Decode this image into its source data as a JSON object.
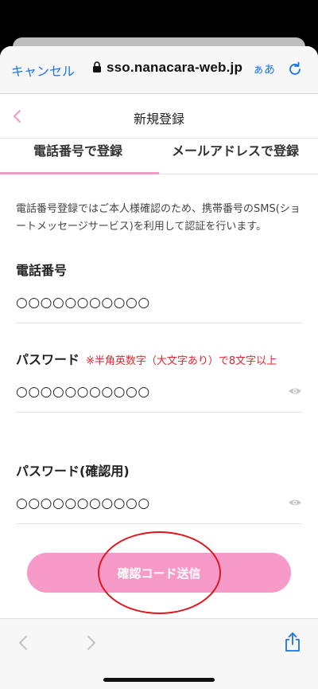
{
  "browser": {
    "cancel_label": "キャンセル",
    "url": "sso.nanacara-web.jp",
    "aa_label": "ぁあ"
  },
  "header": {
    "title": "新規登録"
  },
  "tabs": [
    {
      "label": "電話番号で登録",
      "active": true
    },
    {
      "label": "メールアドレスで登録",
      "active": false
    }
  ],
  "notice": "電話番号登録ではご本人様確認のため、携帯番号のSMS(ショートメッセージサービス)を利用して認証を行います。",
  "fields": {
    "phone": {
      "label": "電話番号",
      "value": "○○○○○○○○○○○"
    },
    "password": {
      "label": "パスワード",
      "note": "※半角英数字（大文字あり）で8文字以上",
      "value": "○○○○○○○○○○○"
    },
    "password_confirm": {
      "label": "パスワード(確認用)",
      "value": "○○○○○○○○○○○"
    }
  },
  "send_button": {
    "label": "確認コード送信"
  },
  "colors": {
    "accent_pink": "#f69ac7",
    "link_blue": "#1a73e8",
    "warning_red": "#e0252e"
  }
}
